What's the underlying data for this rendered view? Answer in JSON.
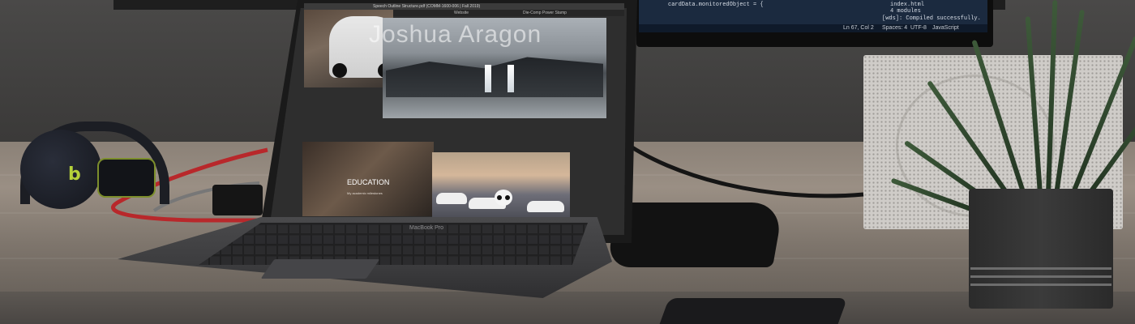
{
  "scene": {
    "description_tags": [
      "laptop",
      "desk",
      "headphones",
      "plant",
      "monitor",
      "phone"
    ]
  },
  "laptop": {
    "brand_label": "MacBook Pro",
    "window_title": "Speech Outline Structure.pdf (COMM-1600-006 | Fall 2019)",
    "tab_left": "Website",
    "tab_right": "Die-Comp Power Stamp",
    "hero_title": "Joshua Aragon",
    "card_education_label": "EDUCATION",
    "card_education_sub": "My academic milestones"
  },
  "monitor": {
    "code_lines": [
      "cardData.monitoredObject = {",
      "4 modules",
      "[wds]: Compiled successfully."
    ],
    "status": {
      "cursor": "Ln 67, Col 2",
      "spaces": "Spaces: 4",
      "encoding": "UTF-8",
      "language": "JavaScript",
      "file_hint": "index.html"
    }
  },
  "colors": {
    "headphone_accent": "#b5d13a",
    "cable_red": "#b8282b",
    "wall": "#3d3c3b",
    "desk": "#8b8177"
  }
}
